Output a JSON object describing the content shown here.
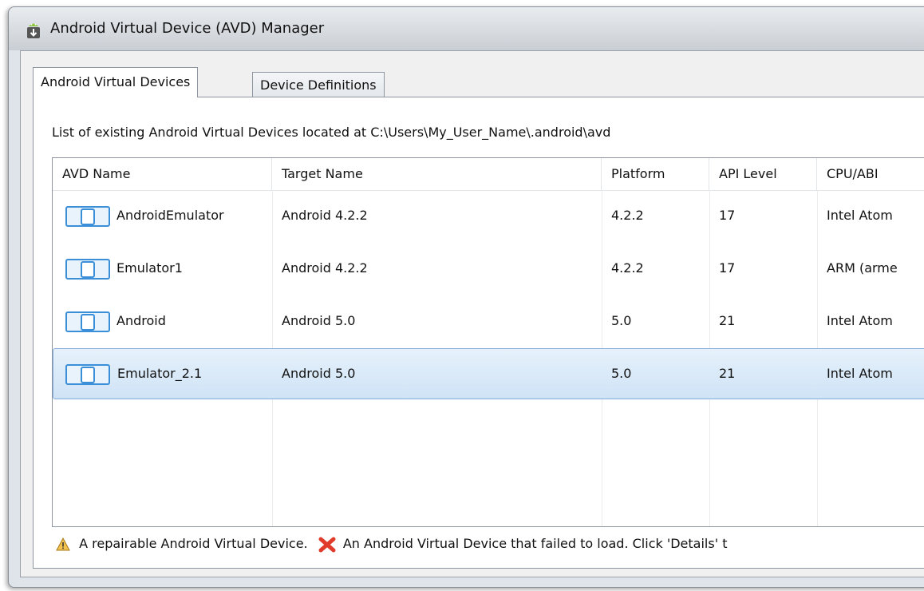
{
  "window": {
    "title": "Android Virtual Device (AVD) Manager"
  },
  "tabs": [
    {
      "label": "Android Virtual Devices",
      "active": true
    },
    {
      "label": "Device Definitions",
      "active": false
    }
  ],
  "info": {
    "location_text": "List of existing Android Virtual Devices located at C:\\Users\\My_User_Name\\.android\\avd"
  },
  "table": {
    "columns": [
      "AVD Name",
      "Target Name",
      "Platform",
      "API Level",
      "CPU/ABI"
    ],
    "rows": [
      {
        "name": "AndroidEmulator",
        "target": "Android 4.2.2",
        "platform": "4.2.2",
        "api": "17",
        "cpu": "Intel Atom",
        "selected": false
      },
      {
        "name": "Emulator1",
        "target": "Android 4.2.2",
        "platform": "4.2.2",
        "api": "17",
        "cpu": "ARM (arme",
        "selected": false
      },
      {
        "name": "Android",
        "target": "Android 5.0",
        "platform": "5.0",
        "api": "21",
        "cpu": "Intel Atom",
        "selected": false
      },
      {
        "name": "Emulator_2.1",
        "target": "Android 5.0",
        "platform": "5.0",
        "api": "21",
        "cpu": "Intel Atom",
        "selected": true
      }
    ]
  },
  "legend": {
    "repairable_text": "A repairable Android Virtual Device.",
    "failed_text": "An Android Virtual Device that failed to load. Click 'Details' t",
    "repairable_icon": "warning-icon",
    "failed_icon": "error-x-icon"
  },
  "colors": {
    "selection_fill": "#cfe3f6",
    "selection_border": "#84acdd",
    "device_icon": "#3a8fd8",
    "warning": "#e0a020",
    "error": "#e03a2a"
  }
}
